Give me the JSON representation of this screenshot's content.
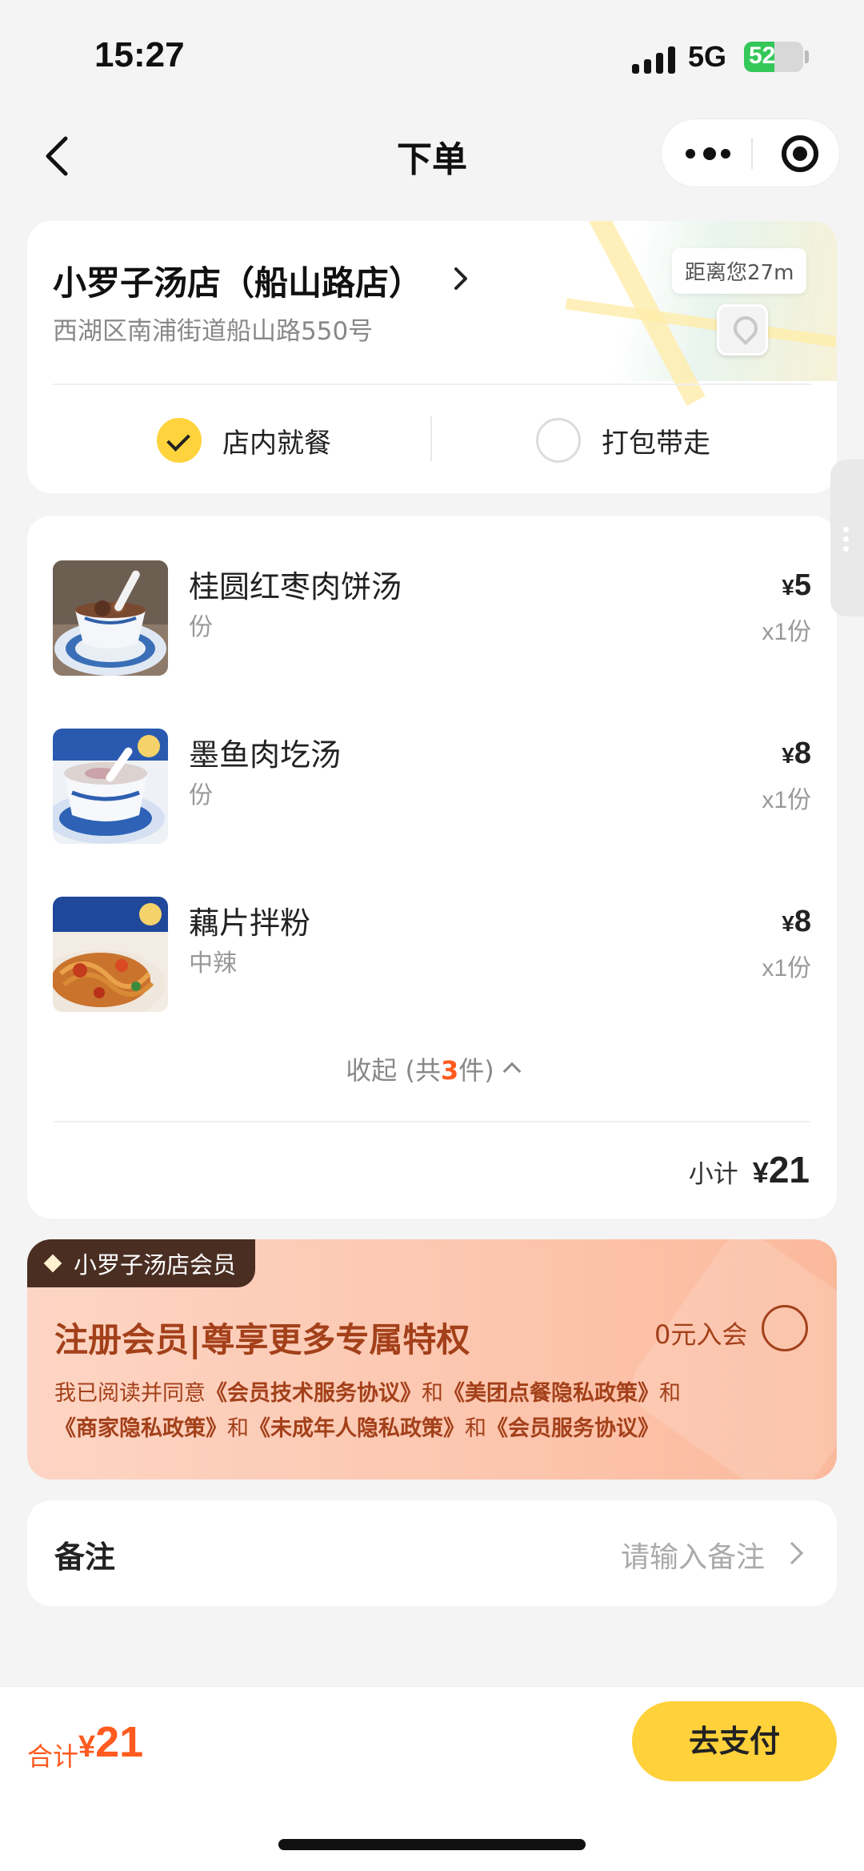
{
  "status_bar": {
    "time": "15:27",
    "network": "5G",
    "battery": "52",
    "battery_level": 0.52
  },
  "nav": {
    "title": "下单"
  },
  "store": {
    "name": "小罗子汤店（船山路店）",
    "address": "西湖区南浦街道船山路550号",
    "distance": "距离您27m",
    "dine_modes": [
      {
        "label": "店内就餐",
        "selected": true
      },
      {
        "label": "打包带走",
        "selected": false
      }
    ]
  },
  "order": {
    "items": [
      {
        "name": "桂圆红枣肉饼汤",
        "spec": "份",
        "currency": "¥",
        "price": "5",
        "qty": "x1份"
      },
      {
        "name": "墨鱼肉圪汤",
        "spec": "份",
        "currency": "¥",
        "price": "8",
        "qty": "x1份"
      },
      {
        "name": "藕片拌粉",
        "spec": "中辣",
        "currency": "¥",
        "price": "8",
        "qty": "x1份"
      }
    ],
    "collapse": {
      "prefix": "收起 (共",
      "count": "3",
      "suffix": "件)"
    },
    "subtotal_label": "小计",
    "subtotal_currency": "¥",
    "subtotal_value": "21"
  },
  "member": {
    "badge": "小罗子汤店会员",
    "title": "注册会员|尊享更多专属特权",
    "join_label": "0元入会",
    "agreement": {
      "intro": "我已阅读并同意",
      "and": "和",
      "links": [
        "《会员技术服务协议》",
        "《美团点餐隐私政策》",
        "《商家隐私政策》",
        "《未成年人隐私政策》",
        "《会员服务协议》"
      ]
    }
  },
  "remark": {
    "label": "备注",
    "placeholder": "请输入备注"
  },
  "footer": {
    "total_label": "合计",
    "currency": "¥",
    "total_value": "21",
    "pay_label": "去支付"
  },
  "colors": {
    "accent_yellow": "#ffd13a",
    "price_orange": "#ff5a1f",
    "member_brown": "#a3401a",
    "member_bg": "#fcc5ad"
  },
  "icons": [
    "back-icon",
    "more-icon",
    "target-icon",
    "chevron-right-icon",
    "location-pin-icon",
    "check-icon",
    "chevron-up-icon",
    "diamond-icon"
  ]
}
